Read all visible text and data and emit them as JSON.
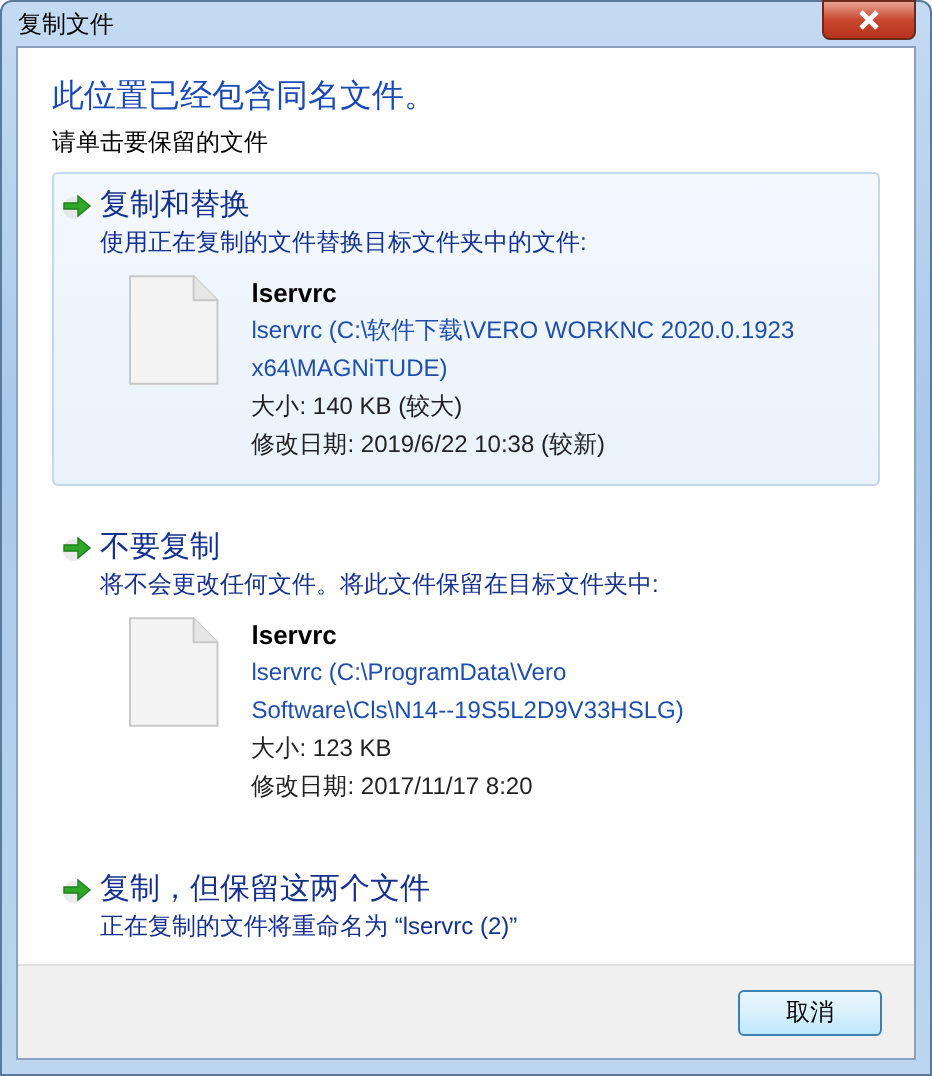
{
  "window": {
    "title": "复制文件"
  },
  "heading": "此位置已经包含同名文件。",
  "instruction": "请单击要保留的文件",
  "options": [
    {
      "title": "复制和替换",
      "description": "使用正在复制的文件替换目标文件夹中的文件:",
      "selected": true,
      "file": {
        "name": "lservrc",
        "path": [
          "lservrc (C:\\软件下载\\VERO WORKNC 2020.0.1923",
          "x64\\MAGNiTUDE)"
        ],
        "size": "大小: 140 KB (较大)",
        "modified": "修改日期: 2019/6/22 10:38 (较新)"
      }
    },
    {
      "title": "不要复制",
      "description": "将不会更改任何文件。将此文件保留在目标文件夹中:",
      "selected": false,
      "file": {
        "name": "lservrc",
        "path": [
          "lservrc (C:\\ProgramData\\Vero",
          "Software\\Cls\\N14--19S5L2D9V33HSLG)"
        ],
        "size": "大小: 123 KB",
        "modified": "修改日期: 2017/11/17 8:20"
      }
    },
    {
      "title": "复制，但保留这两个文件",
      "description": "正在复制的文件将重命名为 “lservrc (2)”",
      "selected": false
    }
  ],
  "buttons": [
    {
      "label": "取消"
    }
  ]
}
